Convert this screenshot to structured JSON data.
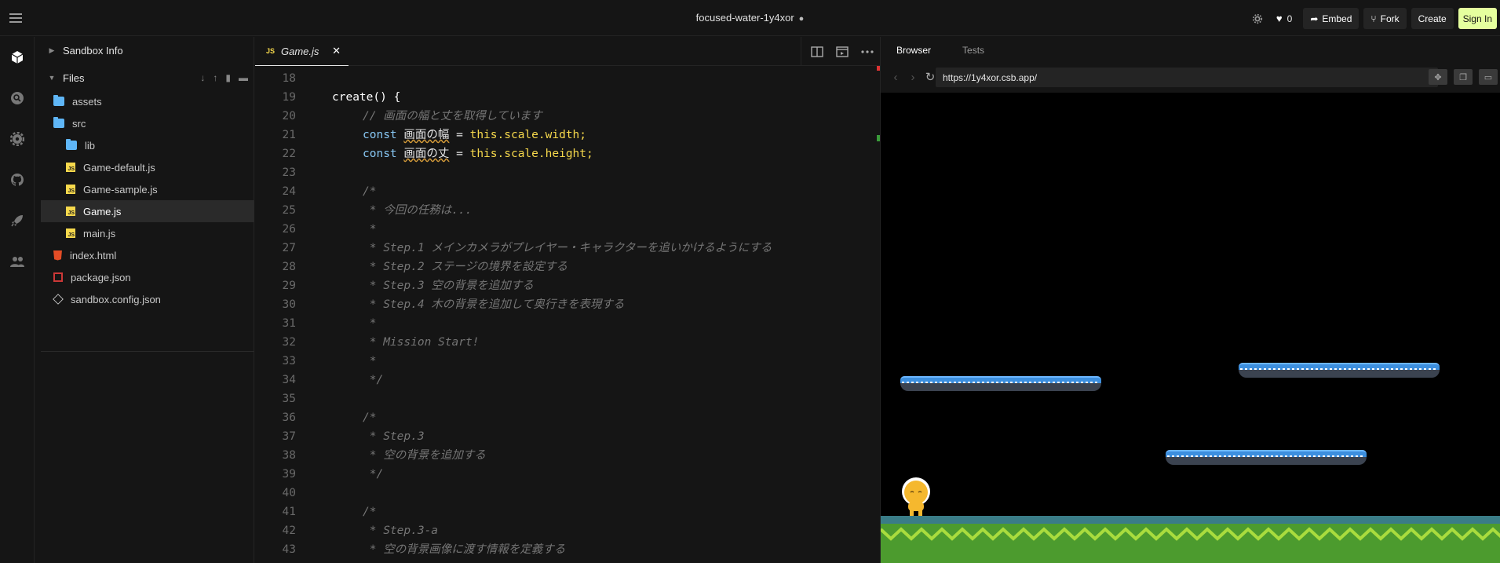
{
  "header": {
    "title": "focused-water-1y4xor",
    "like_count": "0",
    "embed_label": "Embed",
    "fork_label": "Fork",
    "create_label": "Create",
    "signin_label": "Sign In"
  },
  "activity_bar": [
    "cube-icon",
    "search-icon",
    "gear-icon",
    "github-icon",
    "rocket-icon",
    "users-icon"
  ],
  "sidebar": {
    "sandbox_info_label": "Sandbox Info",
    "files_label": "Files",
    "files": [
      {
        "name": "assets",
        "type": "folder",
        "depth": 0
      },
      {
        "name": "src",
        "type": "folder",
        "depth": 0
      },
      {
        "name": "lib",
        "type": "folder",
        "depth": 1
      },
      {
        "name": "Game-default.js",
        "type": "js",
        "depth": 1
      },
      {
        "name": "Game-sample.js",
        "type": "js",
        "depth": 1
      },
      {
        "name": "Game.js",
        "type": "js",
        "depth": 1,
        "selected": true
      },
      {
        "name": "main.js",
        "type": "js",
        "depth": 1
      },
      {
        "name": "index.html",
        "type": "html",
        "depth": 0
      },
      {
        "name": "package.json",
        "type": "pkg",
        "depth": 0
      },
      {
        "name": "sandbox.config.json",
        "type": "config",
        "depth": 0
      }
    ]
  },
  "editor": {
    "tab_label": "Game.js",
    "tab_badge": "JS",
    "lines": [
      {
        "n": "18",
        "tokens": []
      },
      {
        "n": "19",
        "tokens": [
          {
            "t": "create() {",
            "c": "fn"
          }
        ]
      },
      {
        "n": "20",
        "indent": 1,
        "tokens": [
          {
            "t": "// 画面の幅と丈を取得しています",
            "c": "cm"
          }
        ]
      },
      {
        "n": "21",
        "indent": 1,
        "tokens": [
          {
            "t": "const ",
            "c": "kw"
          },
          {
            "t": "画面の幅",
            "c": "id",
            "w": true
          },
          {
            "t": " = ",
            "c": "op"
          },
          {
            "t": "this",
            "c": "this"
          },
          {
            "t": ".scale.width;",
            "c": "prop"
          }
        ]
      },
      {
        "n": "22",
        "indent": 1,
        "tokens": [
          {
            "t": "const ",
            "c": "kw"
          },
          {
            "t": "画面の丈",
            "c": "id",
            "w": true
          },
          {
            "t": " = ",
            "c": "op"
          },
          {
            "t": "this",
            "c": "this"
          },
          {
            "t": ".scale.height;",
            "c": "prop"
          }
        ]
      },
      {
        "n": "23",
        "tokens": []
      },
      {
        "n": "24",
        "indent": 1,
        "tokens": [
          {
            "t": "/*",
            "c": "cm"
          }
        ]
      },
      {
        "n": "25",
        "indent": 1,
        "tokens": [
          {
            "t": " * 今回の任務は...",
            "c": "cm"
          }
        ]
      },
      {
        "n": "26",
        "indent": 1,
        "tokens": [
          {
            "t": " *",
            "c": "cm"
          }
        ]
      },
      {
        "n": "27",
        "indent": 1,
        "tokens": [
          {
            "t": " * Step.1 メインカメラがプレイヤー・キャラクターを追いかけるようにする",
            "c": "cm"
          }
        ]
      },
      {
        "n": "28",
        "indent": 1,
        "tokens": [
          {
            "t": " * Step.2 ステージの境界を設定する",
            "c": "cm"
          }
        ]
      },
      {
        "n": "29",
        "indent": 1,
        "tokens": [
          {
            "t": " * Step.3 空の背景を追加する",
            "c": "cm"
          }
        ]
      },
      {
        "n": "30",
        "indent": 1,
        "tokens": [
          {
            "t": " * Step.4 木の背景を追加して奥行きを表現する",
            "c": "cm"
          }
        ]
      },
      {
        "n": "31",
        "indent": 1,
        "tokens": [
          {
            "t": " *",
            "c": "cm"
          }
        ]
      },
      {
        "n": "32",
        "indent": 1,
        "tokens": [
          {
            "t": " * Mission Start!",
            "c": "cm"
          }
        ]
      },
      {
        "n": "33",
        "indent": 1,
        "tokens": [
          {
            "t": " *",
            "c": "cm"
          }
        ]
      },
      {
        "n": "34",
        "indent": 1,
        "tokens": [
          {
            "t": " */",
            "c": "cm"
          }
        ]
      },
      {
        "n": "35",
        "tokens": []
      },
      {
        "n": "36",
        "indent": 1,
        "tokens": [
          {
            "t": "/*",
            "c": "cm"
          }
        ]
      },
      {
        "n": "37",
        "indent": 1,
        "tokens": [
          {
            "t": " * Step.3",
            "c": "cm"
          }
        ]
      },
      {
        "n": "38",
        "indent": 1,
        "tokens": [
          {
            "t": " * 空の背景を追加する",
            "c": "cm"
          }
        ]
      },
      {
        "n": "39",
        "indent": 1,
        "tokens": [
          {
            "t": " */",
            "c": "cm"
          }
        ]
      },
      {
        "n": "40",
        "tokens": []
      },
      {
        "n": "41",
        "indent": 1,
        "tokens": [
          {
            "t": "/*",
            "c": "cm"
          }
        ]
      },
      {
        "n": "42",
        "indent": 1,
        "tokens": [
          {
            "t": " * Step.3-a",
            "c": "cm"
          }
        ]
      },
      {
        "n": "43",
        "indent": 1,
        "tokens": [
          {
            "t": " * 空の背景画像に渡す情報を定義する",
            "c": "cm"
          }
        ]
      }
    ]
  },
  "preview": {
    "tab_browser": "Browser",
    "tab_tests": "Tests",
    "url": "https://1y4xor.csb.app/"
  },
  "colors": {
    "accent_signin": "#e5ff9e",
    "background": "#151515",
    "keyword": "#88c8f5",
    "property": "#f7d94c",
    "comment": "#757575"
  }
}
